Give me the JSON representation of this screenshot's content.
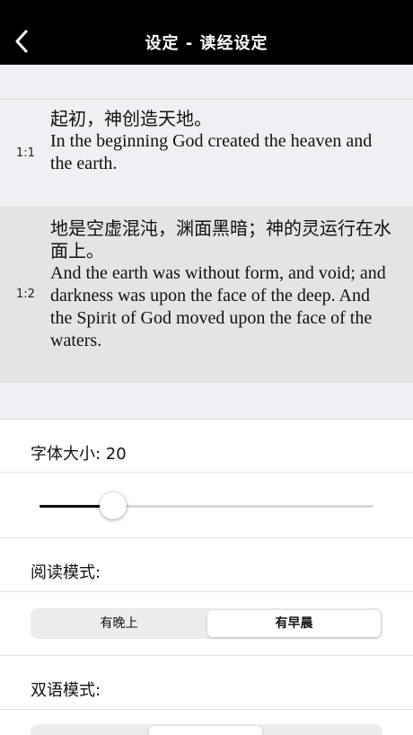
{
  "navbar": {
    "title": "设定 - 读经设定",
    "back_icon": "chevron-left-icon"
  },
  "preview": {
    "verses": [
      {
        "ref": "1:1",
        "cn": "起初，神创造天地。",
        "en": "In the beginning God created the heaven and the earth."
      },
      {
        "ref": "1:2",
        "cn": "地是空虚混沌，渊面黑暗；神的灵运行在水面上。",
        "en": "And the earth was without form, and void; and darkness was upon the face of the deep. And the Spirit of God moved upon the face of the waters."
      }
    ]
  },
  "settings": {
    "font_size_label": "字体大小: 20",
    "font_size_slider_fraction": 0.22,
    "reading_mode_label": "阅读模式:",
    "reading_mode_options": [
      "有晚上",
      "有早晨"
    ],
    "reading_mode_selected": 1,
    "bilingual_mode_label": "双语模式:"
  },
  "colors": {
    "navbar_bg": "#000000",
    "page_bg": "#efeff4",
    "highlight_bg": "#e4e4e4",
    "slider_fill": "#000000"
  }
}
